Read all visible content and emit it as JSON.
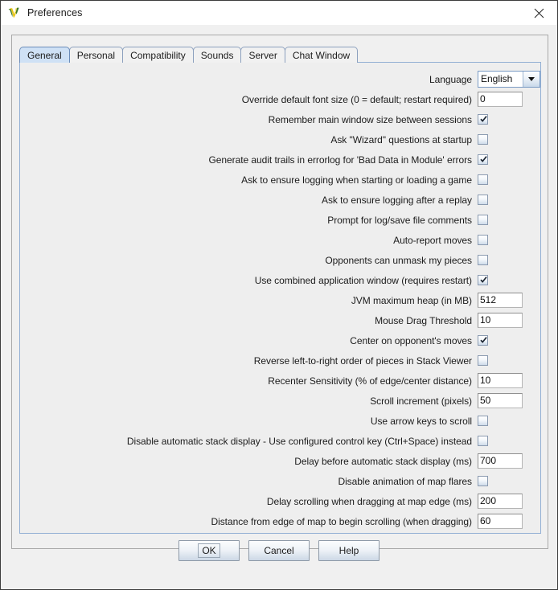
{
  "window": {
    "title": "Preferences",
    "icon": "vassal-logo-icon",
    "close_icon": "close-icon"
  },
  "tabs": [
    {
      "label": "General",
      "active": true
    },
    {
      "label": "Personal",
      "active": false
    },
    {
      "label": "Compatibility",
      "active": false
    },
    {
      "label": "Sounds",
      "active": false
    },
    {
      "label": "Server",
      "active": false
    },
    {
      "label": "Chat Window",
      "active": false
    }
  ],
  "settings": [
    {
      "name": "language",
      "label": "Language",
      "type": "combo",
      "value": "English"
    },
    {
      "name": "override-default-font-size",
      "label": "Override default font size (0 = default; restart required)",
      "type": "text",
      "value": "0"
    },
    {
      "name": "remember-main-window-size",
      "label": "Remember main window size between sessions",
      "type": "checkbox",
      "checked": true
    },
    {
      "name": "ask-wizard-questions",
      "label": "Ask \"Wizard\" questions at startup",
      "type": "checkbox",
      "checked": false
    },
    {
      "name": "generate-audit-trails",
      "label": "Generate audit trails in errorlog for 'Bad Data in Module' errors",
      "type": "checkbox",
      "checked": true
    },
    {
      "name": "ask-ensure-logging-start",
      "label": "Ask to ensure logging when starting or loading a game",
      "type": "checkbox",
      "checked": false
    },
    {
      "name": "ask-ensure-logging-replay",
      "label": "Ask to ensure logging after a replay",
      "type": "checkbox",
      "checked": false
    },
    {
      "name": "prompt-log-save-comments",
      "label": "Prompt for log/save file comments",
      "type": "checkbox",
      "checked": false
    },
    {
      "name": "auto-report-moves",
      "label": "Auto-report moves",
      "type": "checkbox",
      "checked": false
    },
    {
      "name": "opponents-unmask-pieces",
      "label": "Opponents can unmask my pieces",
      "type": "checkbox",
      "checked": false
    },
    {
      "name": "use-combined-application-window",
      "label": "Use combined application window (requires restart)",
      "type": "checkbox",
      "checked": true
    },
    {
      "name": "jvm-maximum-heap",
      "label": "JVM maximum heap (in MB)",
      "type": "text",
      "value": "512"
    },
    {
      "name": "mouse-drag-threshold",
      "label": "Mouse Drag Threshold",
      "type": "text",
      "value": "10"
    },
    {
      "name": "center-on-opponents-moves",
      "label": "Center on opponent's moves",
      "type": "checkbox",
      "checked": true
    },
    {
      "name": "reverse-stack-viewer-order",
      "label": "Reverse left-to-right order of pieces in Stack Viewer",
      "type": "checkbox",
      "checked": false
    },
    {
      "name": "recenter-sensitivity",
      "label": "Recenter Sensitivity (% of edge/center distance)",
      "type": "text",
      "value": "10"
    },
    {
      "name": "scroll-increment",
      "label": "Scroll increment (pixels)",
      "type": "text",
      "value": "50"
    },
    {
      "name": "use-arrow-keys-to-scroll",
      "label": "Use arrow keys to scroll",
      "type": "checkbox",
      "checked": false
    },
    {
      "name": "disable-automatic-stack-display",
      "label": "Disable automatic stack display - Use configured control key (Ctrl+Space) instead",
      "type": "checkbox",
      "checked": false
    },
    {
      "name": "delay-before-stack-display",
      "label": "Delay before automatic stack display (ms)",
      "type": "text",
      "value": "700"
    },
    {
      "name": "disable-map-flare-animation",
      "label": "Disable animation of map flares",
      "type": "checkbox",
      "checked": false
    },
    {
      "name": "delay-scrolling-map-edge",
      "label": "Delay scrolling when dragging at map edge (ms)",
      "type": "text",
      "value": "200"
    },
    {
      "name": "distance-from-edge-scroll",
      "label": "Distance from edge of map to begin scrolling (when dragging)",
      "type": "text",
      "value": "60"
    }
  ],
  "buttons": [
    {
      "name": "ok-button",
      "label": "OK",
      "focused": true
    },
    {
      "name": "cancel-button",
      "label": "Cancel",
      "focused": false
    },
    {
      "name": "help-button",
      "label": "Help",
      "focused": false
    }
  ],
  "colors": {
    "window_bg": "#f0f0f0",
    "titlebar_bg": "#ffffff",
    "tab_active_bg": "#cfe1f5",
    "tabpane_border": "#93b0d4",
    "text": "#1c1c1c"
  }
}
